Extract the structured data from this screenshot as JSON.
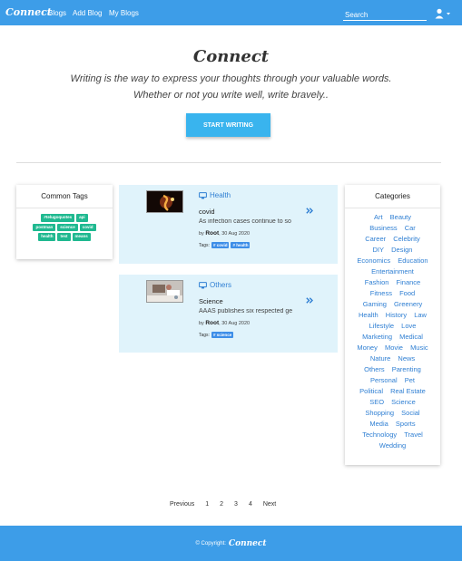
{
  "navbar": {
    "brand": "Connect",
    "links": [
      "Blogs",
      "Add Blog",
      "My Blogs"
    ],
    "search_placeholder": "Search",
    "user_icon": "user-icon",
    "caret_icon": "caret-down-icon"
  },
  "hero": {
    "title": "Connect",
    "tagline_1": "Writing is the way to express your thoughts through your valuable words.",
    "tagline_2": "Whether or not you write well, write bravely..",
    "button": "START WRITING"
  },
  "common_tags": {
    "heading": "Common Tags",
    "tags": [
      "#telugoquotes",
      "api",
      "postman",
      "science",
      "covid",
      "health",
      "test",
      "means"
    ]
  },
  "posts": [
    {
      "category": "Health",
      "category_icon": "monitor-icon",
      "title": "covid",
      "excerpt": "As infection cases continue to so",
      "by_label": "by",
      "author": "Root",
      "date": ", 30 Aug 2020",
      "tags_label": "Tags:",
      "tags": [
        "# covid",
        "# health"
      ],
      "more_icon": "double-chevron-right-icon"
    },
    {
      "category": "Others",
      "category_icon": "monitor-icon",
      "title": "Science",
      "excerpt": "AAAS publishes six respected ge",
      "by_label": "by",
      "author": "Root",
      "date": ", 30 Aug 2020",
      "tags_label": "Tags:",
      "tags": [
        "# science"
      ],
      "more_icon": "double-chevron-right-icon"
    }
  ],
  "categories": {
    "heading": "Categories",
    "items": [
      "Art",
      "Beauty",
      "Business",
      "Car",
      "Career",
      "Celebrity",
      "DIY",
      "Design",
      "Economics",
      "Education",
      "Entertainment",
      "Fashion",
      "Finance",
      "Fitness",
      "Food",
      "Gaming",
      "Greenery",
      "Health",
      "History",
      "Law",
      "Lifestyle",
      "Love",
      "Marketing",
      "Medical",
      "Money",
      "Movie",
      "Music",
      "Nature",
      "News",
      "Others",
      "Parenting",
      "Personal",
      "Pet",
      "Political",
      "Real Estate",
      "SEO",
      "Science",
      "Shopping",
      "Social",
      "Media",
      "Sports",
      "Technology",
      "Travel",
      "Wedding"
    ]
  },
  "pagination": {
    "previous": "Previous",
    "pages": [
      "1",
      "2",
      "3",
      "4"
    ],
    "next": "Next"
  },
  "footer": {
    "copyright": "© Copyright:",
    "brand": "Connect"
  },
  "colors": {
    "primary": "#3d9de8",
    "button": "#39b4ee",
    "tag_green": "#1fb990",
    "post_bg": "#e0f3fb",
    "link": "#2f7fd3"
  }
}
